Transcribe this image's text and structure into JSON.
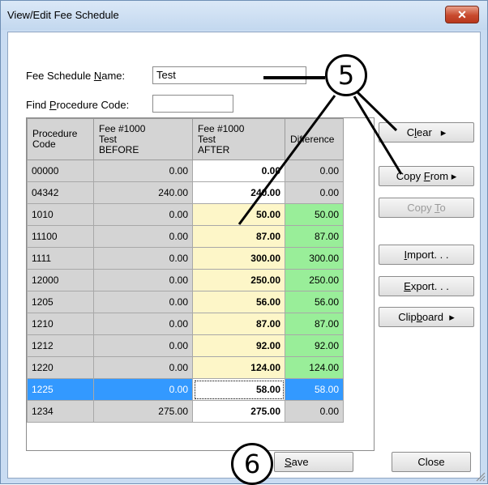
{
  "window": {
    "title": "View/Edit Fee Schedule",
    "close_glyph": "✕"
  },
  "form": {
    "name_label_pre": "Fee Schedule ",
    "name_label_key": "N",
    "name_label_post": "ame:",
    "name_value": "Test",
    "find_label_pre": "Find ",
    "find_label_key": "P",
    "find_label_post": "rocedure Code:",
    "find_value": ""
  },
  "grid": {
    "headers": [
      [
        "Procedure",
        "Code"
      ],
      [
        "Fee #1000",
        "Test",
        "BEFORE"
      ],
      [
        "Fee #1000",
        "Test",
        "AFTER"
      ],
      [
        "Difference"
      ]
    ],
    "rows": [
      {
        "code": "00000",
        "before": "0.00",
        "after": "0.00",
        "diff": "0.00",
        "state": "unchanged"
      },
      {
        "code": "04342",
        "before": "240.00",
        "after": "240.00",
        "diff": "0.00",
        "state": "unchanged"
      },
      {
        "code": "1010",
        "before": "0.00",
        "after": "50.00",
        "diff": "50.00",
        "state": "changed"
      },
      {
        "code": "11100",
        "before": "0.00",
        "after": "87.00",
        "diff": "87.00",
        "state": "changed"
      },
      {
        "code": "1111",
        "before": "0.00",
        "after": "300.00",
        "diff": "300.00",
        "state": "changed"
      },
      {
        "code": "12000",
        "before": "0.00",
        "after": "250.00",
        "diff": "250.00",
        "state": "changed"
      },
      {
        "code": "1205",
        "before": "0.00",
        "after": "56.00",
        "diff": "56.00",
        "state": "changed"
      },
      {
        "code": "1210",
        "before": "0.00",
        "after": "87.00",
        "diff": "87.00",
        "state": "changed"
      },
      {
        "code": "1212",
        "before": "0.00",
        "after": "92.00",
        "diff": "92.00",
        "state": "changed"
      },
      {
        "code": "1220",
        "before": "0.00",
        "after": "124.00",
        "diff": "124.00",
        "state": "changed"
      },
      {
        "code": "1225",
        "before": "0.00",
        "after": "58.00",
        "diff": "58.00",
        "state": "selected"
      },
      {
        "code": "1234",
        "before": "275.00",
        "after": "275.00",
        "diff": "0.00",
        "state": "unchanged"
      }
    ]
  },
  "buttons": {
    "clear": {
      "pre": "C",
      "key": "l",
      "post": "ear",
      "arrow": "▸"
    },
    "copy_from": {
      "pre": "Copy ",
      "key": "F",
      "post": "rom",
      "arrow": "▸"
    },
    "copy_to": {
      "pre": "Copy ",
      "key": "T",
      "post": "o"
    },
    "import": {
      "pre": "",
      "key": "I",
      "post": "mport. . ."
    },
    "export": {
      "pre": "",
      "key": "E",
      "post": "xport. . ."
    },
    "clipboard": {
      "pre": "Clip",
      "key": "b",
      "post": "oard",
      "arrow": "▸"
    },
    "save": {
      "pre": "",
      "key": "S",
      "post": "ave"
    },
    "close": "Close"
  },
  "callouts": {
    "five": "5",
    "six": "6"
  },
  "colors": {
    "changed_after": "#fdf6c8",
    "changed_diff": "#99ee99",
    "selected_bg": "#3399ff",
    "selected_text": "#ffffff",
    "header_bg": "#d4d4d4",
    "unchanged_after": "#ffffff"
  },
  "icons": {
    "scroll_up": "▲",
    "scroll_down": "▼"
  }
}
